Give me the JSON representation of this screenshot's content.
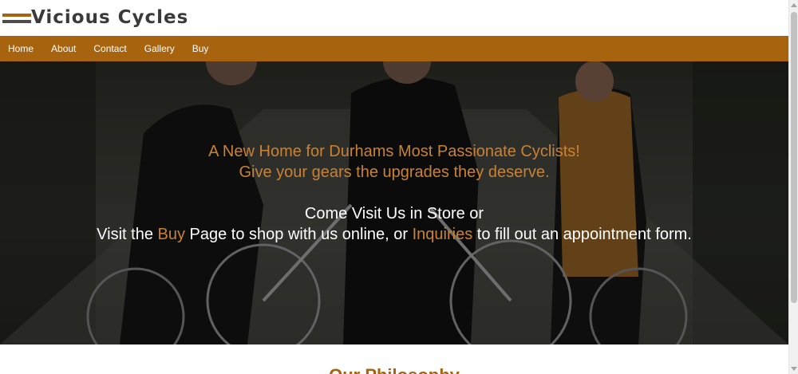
{
  "site": {
    "logo_text": "Vicious Cycles",
    "colors": {
      "brand": "#a8630f",
      "accent": "#c98233",
      "logo_text": "#3a3a3a"
    }
  },
  "nav": {
    "items": [
      {
        "label": "Home"
      },
      {
        "label": "About"
      },
      {
        "label": "Contact"
      },
      {
        "label": "Gallery"
      },
      {
        "label": "Buy"
      }
    ]
  },
  "hero": {
    "tagline_1": "A New Home for Durhams Most Passionate Cyclists!",
    "tagline_2": "Give your gears the upgrades they deserve.",
    "visit_line_1": "Come Visit Us in Store or",
    "visit_prefix": "Visit the",
    "buy_link": "Buy",
    "visit_middle": "Page to shop with us online, or",
    "inquiries_link": "Inquiries",
    "visit_suffix": "to fill out an appointment form.",
    "image_alt_icon": "cyclists-photo"
  },
  "section": {
    "heading_partial": "Our Philosophy"
  },
  "scrollbar": {
    "up_icon": "chevron-up-icon",
    "down_icon": "chevron-down-icon"
  }
}
